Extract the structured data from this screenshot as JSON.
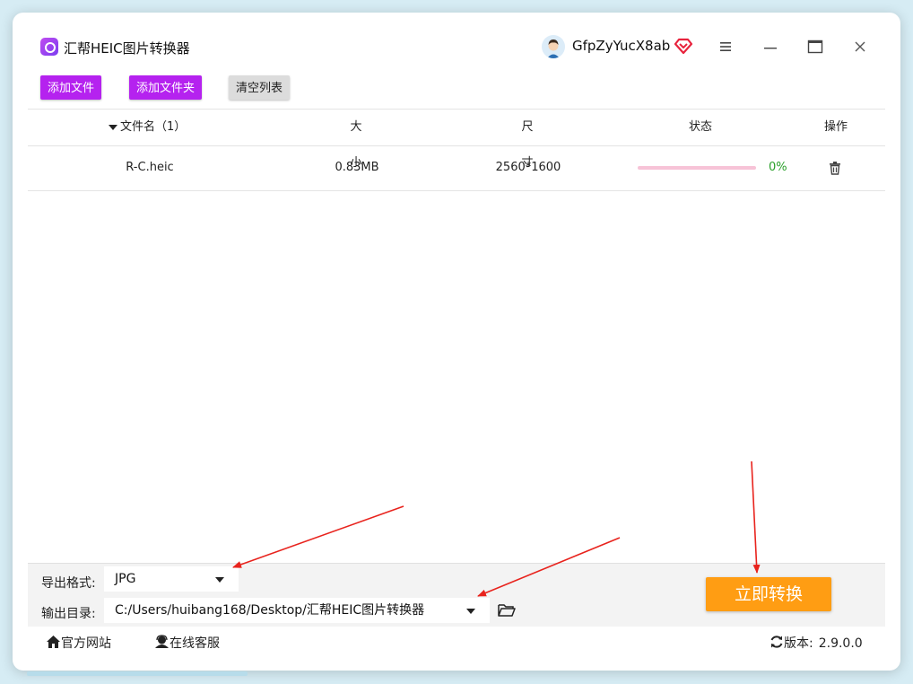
{
  "window": {
    "title": "汇帮HEIC图片转换器",
    "username": "GfpZyYucX8ab"
  },
  "toolbar": {
    "add_file": "添加文件",
    "add_folder": "添加文件夹",
    "clear_list": "清空列表"
  },
  "table": {
    "headers": {
      "name": "文件名（1）",
      "size": "大小",
      "dimensions": "尺寸",
      "status": "状态",
      "action": "操作"
    },
    "rows": [
      {
        "name": "R-C.heic",
        "size": "0.83MB",
        "dimensions": "2560*1600",
        "progress": 0,
        "progress_text": "0%"
      }
    ]
  },
  "output": {
    "format_label": "导出格式:",
    "format_value": "JPG",
    "dir_label": "输出目录:",
    "dir_value": "C:/Users/huibang168/Desktop/汇帮HEIC图片转换器"
  },
  "convert_button": "立即转换",
  "footer": {
    "website": "官方网站",
    "support": "在线客服",
    "version_label": "版本:",
    "version": "2.9.0.0"
  },
  "colors": {
    "accent_purple": "#b522ef",
    "convert_orange": "#ff9d13",
    "progress_pink": "#f7c3d7",
    "percent_green": "#2aa02a",
    "annotation_red": "#e8231d"
  },
  "icons": [
    "app-logo-icon",
    "avatar-icon",
    "vip-diamond-icon",
    "menu-icon",
    "minimize-icon",
    "maximize-icon",
    "close-icon",
    "sort-caret-icon",
    "trash-icon",
    "dropdown-caret-icon",
    "folder-icon",
    "home-icon",
    "support-icon",
    "refresh-icon"
  ]
}
